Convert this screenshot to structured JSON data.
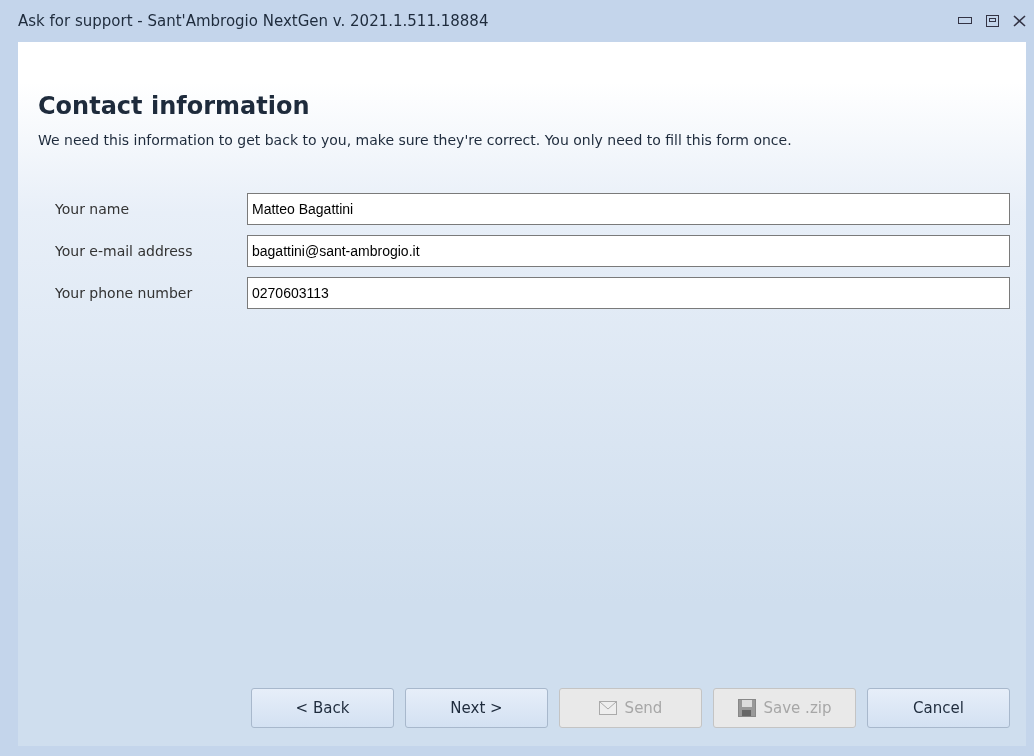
{
  "window": {
    "title": "Ask for support - Sant'Ambrogio NextGen v. 2021.1.511.18884"
  },
  "heading": "Contact information",
  "intro": "We need this information to get back to you, make sure they're correct. You only need to fill this form once.",
  "fields": [
    {
      "label": "Your name",
      "value": "Matteo Bagattini"
    },
    {
      "label": "Your e-mail address",
      "value": "bagattini@sant-ambrogio.it"
    },
    {
      "label": "Your phone number",
      "value": "0270603113"
    }
  ],
  "buttons": [
    {
      "label": "< Back",
      "kind": "plain",
      "disabled": false
    },
    {
      "label": "Next >",
      "kind": "plain",
      "disabled": false
    },
    {
      "label": "Send",
      "kind": "send",
      "disabled": true
    },
    {
      "label": "Save .zip",
      "kind": "save",
      "disabled": true
    },
    {
      "label": "Cancel",
      "kind": "plain",
      "disabled": false
    }
  ]
}
